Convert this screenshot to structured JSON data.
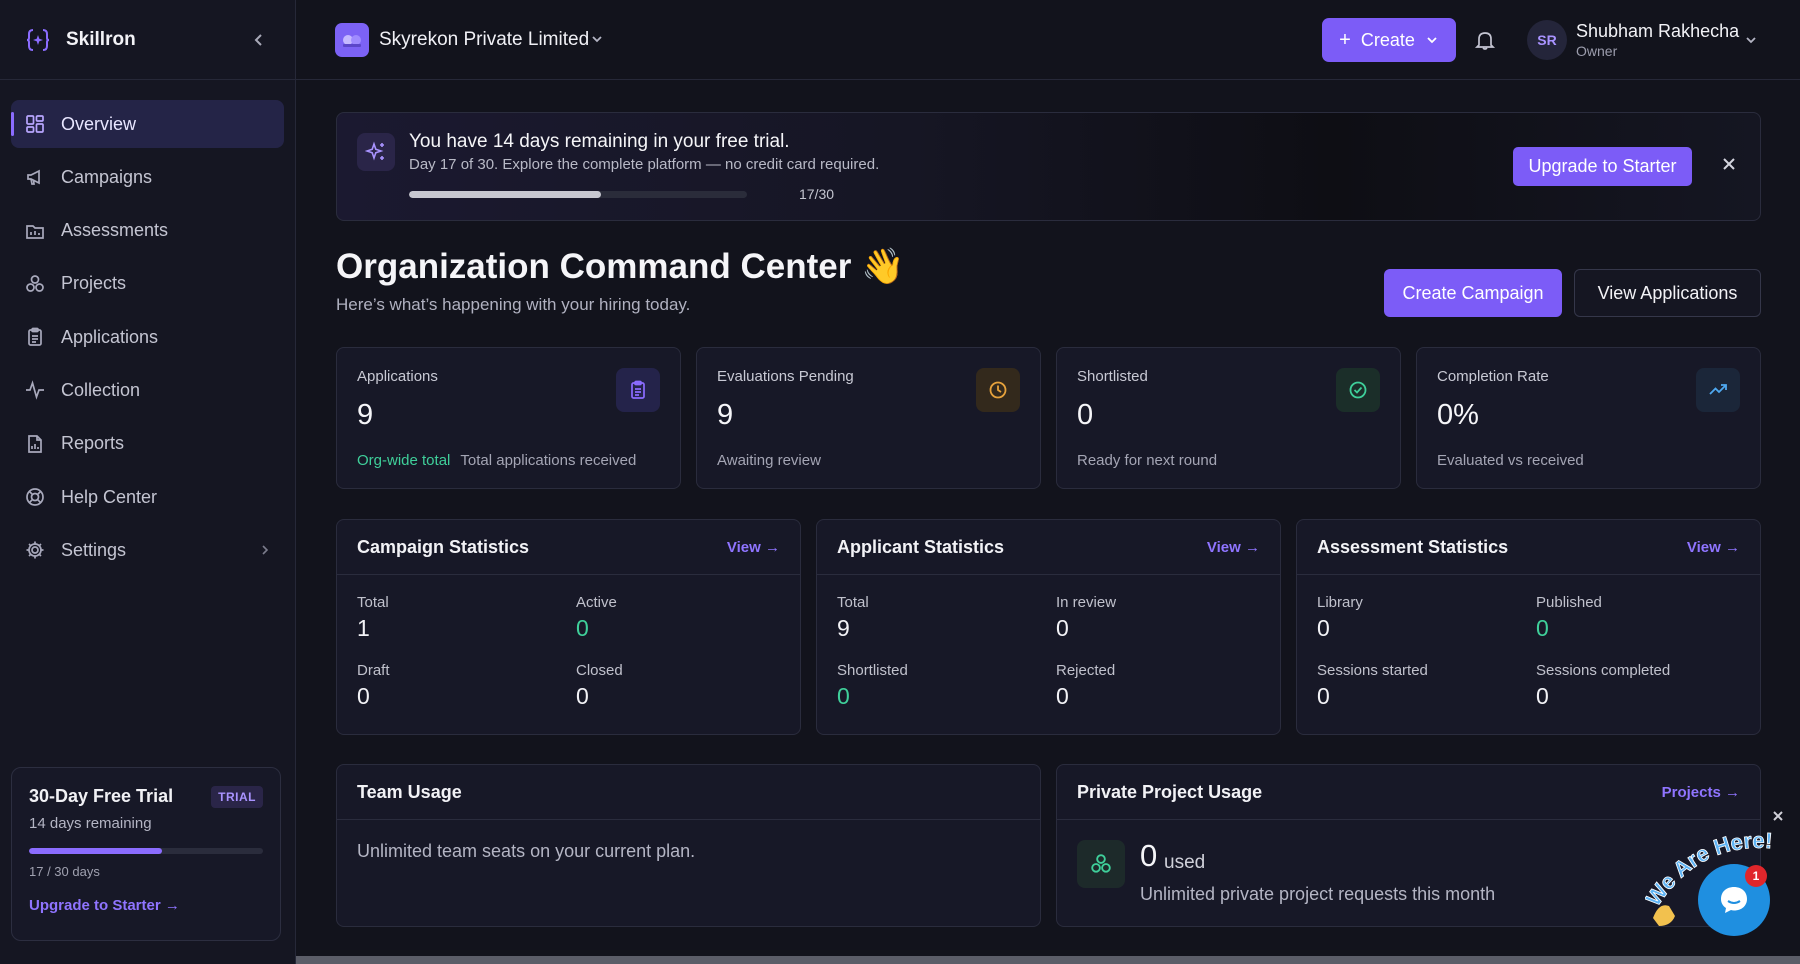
{
  "brand": {
    "name": "Skillron"
  },
  "sidebar": {
    "items": [
      {
        "label": "Overview",
        "icon": "grid-icon",
        "active": true
      },
      {
        "label": "Campaigns",
        "icon": "megaphone-icon"
      },
      {
        "label": "Assessments",
        "icon": "chart-folder-icon"
      },
      {
        "label": "Projects",
        "icon": "cluster-icon"
      },
      {
        "label": "Applications",
        "icon": "clipboard-icon"
      },
      {
        "label": "Collection",
        "icon": "pulse-icon"
      },
      {
        "label": "Reports",
        "icon": "report-icon"
      },
      {
        "label": "Help Center",
        "icon": "lifebuoy-icon"
      },
      {
        "label": "Settings",
        "icon": "gear-icon"
      }
    ],
    "trial": {
      "title": "30-Day Free Trial",
      "badge": "TRIAL",
      "remaining": "14 days remaining",
      "progress": 0.567,
      "count": "17 / 30 days",
      "link": "Upgrade to Starter →"
    }
  },
  "header": {
    "org_name": "Skyrekon Private Limited",
    "create_label": "Create",
    "user": {
      "initials": "SR",
      "name": "Shubham Rakhecha",
      "role": "Owner"
    }
  },
  "banner": {
    "title": "You have 14 days remaining in your free trial.",
    "subtitle": "Day 17 of 30. Explore the complete platform — no credit card required.",
    "progress": 0.567,
    "count": "17/30",
    "upgrade_label": "Upgrade to Starter"
  },
  "page": {
    "title": "Organization Command Center 👋",
    "subtitle": "Here’s what’s happening with your hiring today.",
    "primary_btn": "Create Campaign",
    "secondary_btn": "View Applications"
  },
  "stats": [
    {
      "label": "Applications",
      "value": "9",
      "accent": "Org-wide total",
      "foot": "Total applications received",
      "icon": "clipboard-icon",
      "color": "#8b6cff",
      "bg": "#24234a"
    },
    {
      "label": "Evaluations Pending",
      "value": "9",
      "accent": "",
      "foot": "Awaiting review",
      "icon": "clock-icon",
      "color": "#e6a23c",
      "bg": "#33291c"
    },
    {
      "label": "Shortlisted",
      "value": "0",
      "accent": "",
      "foot": "Ready for next round",
      "icon": "check-circle-icon",
      "color": "#3fcf9a",
      "bg": "#1b2e29"
    },
    {
      "label": "Completion Rate",
      "value": "0%",
      "accent": "",
      "foot": "Evaluated vs received",
      "icon": "trend-up-icon",
      "color": "#4fa8f0",
      "bg": "#1b2639"
    }
  ],
  "panels": {
    "campaign": {
      "title": "Campaign Statistics",
      "link": "View →",
      "metrics": [
        {
          "label": "Total",
          "value": "1"
        },
        {
          "label": "Active",
          "value": "0"
        },
        {
          "label": "Draft",
          "value": "0"
        },
        {
          "label": "Closed",
          "value": "0"
        }
      ]
    },
    "applicant": {
      "title": "Applicant Statistics",
      "link": "View →",
      "metrics": [
        {
          "label": "Total",
          "value": "9"
        },
        {
          "label": "In review",
          "value": "0"
        },
        {
          "label": "Shortlisted",
          "value": "0"
        },
        {
          "label": "Rejected",
          "value": "0"
        }
      ]
    },
    "assessment": {
      "title": "Assessment Statistics",
      "link": "View →",
      "metrics": [
        {
          "label": "Library",
          "value": "0"
        },
        {
          "label": "Published",
          "value": "0"
        },
        {
          "label": "Sessions started",
          "value": "0"
        },
        {
          "label": "Sessions completed",
          "value": "0"
        }
      ]
    },
    "team": {
      "title": "Team Usage",
      "text": "Unlimited team seats on your current plan."
    },
    "project": {
      "title": "Private Project Usage",
      "link": "Projects →",
      "used": "0",
      "used_label": "used",
      "desc": "Unlimited private project requests this month"
    }
  },
  "chat": {
    "badge": "1",
    "wave_text": "We Are Here!"
  }
}
